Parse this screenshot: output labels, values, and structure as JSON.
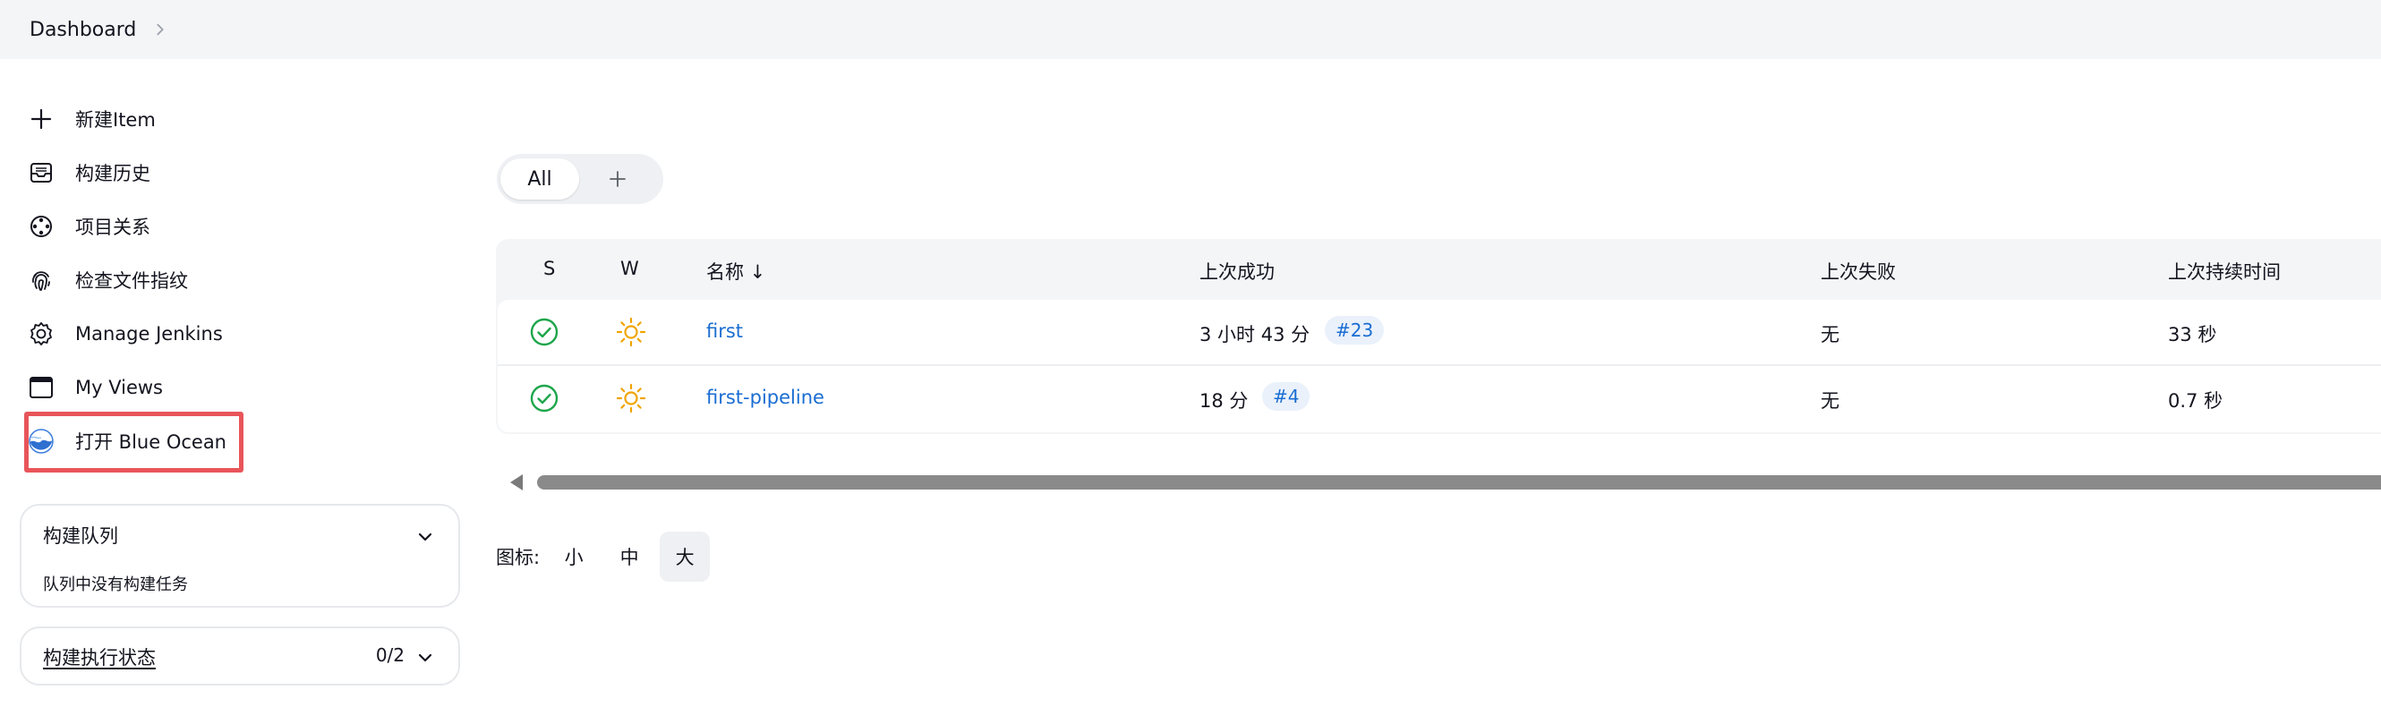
{
  "breadcrumb": {
    "items": [
      "Dashboard"
    ]
  },
  "sidebar": {
    "tasks": [
      {
        "label": "新建Item",
        "icon": "plus-icon"
      },
      {
        "label": "构建历史",
        "icon": "inbox-icon"
      },
      {
        "label": "项目关系",
        "icon": "relationship-icon"
      },
      {
        "label": "检查文件指纹",
        "icon": "fingerprint-icon"
      },
      {
        "label": "Manage Jenkins",
        "icon": "gear-icon"
      },
      {
        "label": "My Views",
        "icon": "window-icon"
      },
      {
        "label": "打开 Blue Ocean",
        "icon": "blue-ocean-icon"
      }
    ],
    "highlight_color": "#e8555a",
    "build_queue": {
      "title": "构建队列",
      "message": "队列中没有构建任务"
    },
    "executors": {
      "title": "构建执行状态",
      "count": "0/2"
    }
  },
  "view_tabs": {
    "tabs": [
      "All"
    ],
    "add_icon": "plus-icon"
  },
  "jobs_table": {
    "headers": {
      "status": "S",
      "weather": "W",
      "name": "名称 ↓",
      "last_success": "上次成功",
      "last_failure": "上次失败",
      "last_duration": "上次持续时间"
    },
    "rows": [
      {
        "status_icon": "success-check-icon",
        "weather_icon": "sunny-icon",
        "name": "first",
        "last_success_time": "3 小时 43 分",
        "last_success_build": "#23",
        "last_failure": "无",
        "last_duration": "33 秒"
      },
      {
        "status_icon": "success-check-icon",
        "weather_icon": "sunny-icon",
        "name": "first-pipeline",
        "last_success_time": "18 分",
        "last_success_build": "#4",
        "last_failure": "无",
        "last_duration": "0.7 秒"
      }
    ],
    "colors": {
      "success": "#1ea64b",
      "weather": "#f0a400",
      "link": "#1a6dd2"
    }
  },
  "icon_size": {
    "label": "图标:",
    "options": [
      "小",
      "中",
      "大"
    ],
    "selected": "大"
  }
}
